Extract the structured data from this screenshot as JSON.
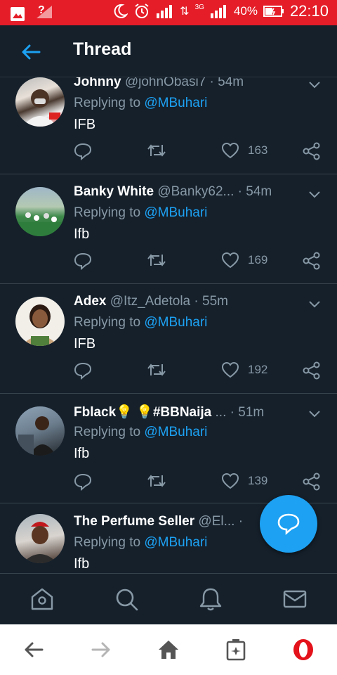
{
  "status_bar": {
    "signal_q": "?",
    "network": "3G",
    "battery_pct": "40%",
    "time": "22:10"
  },
  "header": {
    "title": "Thread"
  },
  "tweets": [
    {
      "name": "Johnny",
      "handle": "@johnObasi7",
      "sep": " · ",
      "time": "54m",
      "reply_prefix": "Replying to ",
      "mention": "@MBuhari",
      "text": "IFB",
      "likes": "163"
    },
    {
      "name": "Banky White",
      "handle": "@Banky62...",
      "sep": " · ",
      "time": "54m",
      "reply_prefix": "Replying to ",
      "mention": "@MBuhari",
      "text": "Ifb",
      "likes": "169"
    },
    {
      "name": "Adex",
      "handle": "@Itz_Adetola",
      "sep": " · ",
      "time": "55m",
      "reply_prefix": "Replying to ",
      "mention": "@MBuhari",
      "text": "IFB",
      "likes": "192"
    },
    {
      "name": "Fblack",
      "emoji1": "💡",
      "emoji2": "💡",
      "name2": "#BBNaija",
      "handle": "...",
      "sep": " · ",
      "time": "51m",
      "reply_prefix": "Replying to ",
      "mention": "@MBuhari",
      "text": "Ifb",
      "likes": "139"
    },
    {
      "name": "The Perfume Seller",
      "handle": "@El...",
      "sep": " · ",
      "time": "",
      "reply_prefix": "Replying to ",
      "mention": "@MBuhari",
      "text": "Ifb",
      "likes": ""
    }
  ],
  "colors": {
    "accent": "#1da1f2",
    "background": "#15202b",
    "muted": "#8899a6",
    "status_bar": "#e41d28",
    "opera": "#e3121b"
  }
}
